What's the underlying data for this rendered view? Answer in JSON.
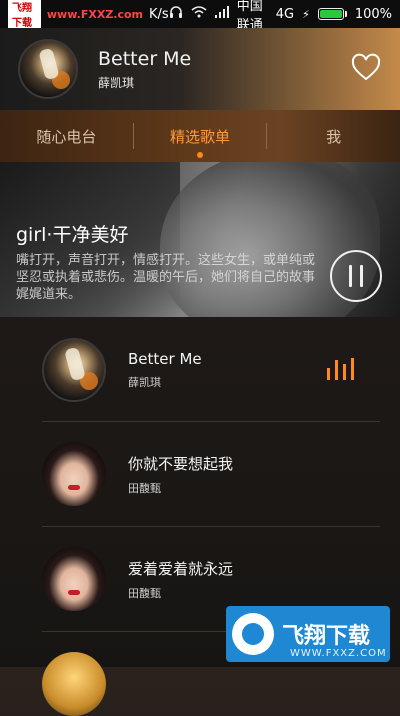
{
  "status_bar": {
    "badge": "飞翔下载",
    "url": "www.FXXZ.com",
    "speed": "K/s",
    "carrier": "中国联通",
    "network": "4G",
    "battery_percent": 100,
    "battery_label": "100%"
  },
  "now_playing": {
    "title": "Better Me",
    "artist": "薛凯琪"
  },
  "tabs": [
    {
      "label": "随心电台",
      "active": false
    },
    {
      "label": "精选歌单",
      "active": true
    },
    {
      "label": "我",
      "active": false
    }
  ],
  "banner": {
    "title": "girl·干净美好",
    "description": "嘴打开，声音打开，情感打开。这些女生，或单纯或坚忍或执着或悲伤。温暖的午后，她们将自己的故事娓娓道来。"
  },
  "songs": [
    {
      "title": "Better Me",
      "artist": "薛凯琪",
      "playing": true
    },
    {
      "title": "你就不要想起我",
      "artist": "田馥甄",
      "playing": false
    },
    {
      "title": "爱着爱着就永远",
      "artist": "田馥甄",
      "playing": false
    }
  ],
  "watermark": {
    "brand": "飞翔下载",
    "url": "WWW.FXXZ.COM"
  },
  "colors": {
    "accent": "#ff8a1f",
    "battery": "#27c93f"
  }
}
